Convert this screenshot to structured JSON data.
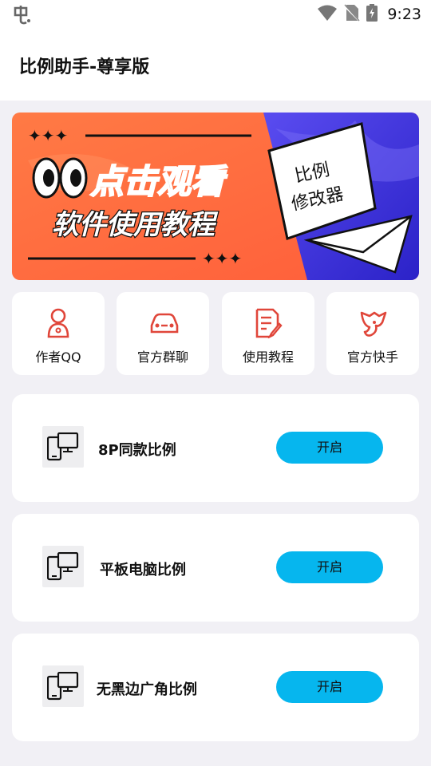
{
  "status_bar": {
    "time": "9:23",
    "icons": [
      "app-notification-icon",
      "wifi-icon",
      "no-sim-icon",
      "battery-charging-icon"
    ]
  },
  "app_bar": {
    "title": "比例助手-尊享版"
  },
  "banner": {
    "headline": "点击观看",
    "subheadline": "软件使用教程",
    "card_line1": "比例",
    "card_line2": "修改器",
    "colors": {
      "orange": "#ff6a3d",
      "blue": "#3b2fe0"
    }
  },
  "quick_actions": [
    {
      "label": "作者QQ",
      "icon": "person-icon"
    },
    {
      "label": "官方群聊",
      "icon": "car-icon"
    },
    {
      "label": "使用教程",
      "icon": "document-edit-icon"
    },
    {
      "label": "官方快手",
      "icon": "kuaishou-icon"
    }
  ],
  "modes": [
    {
      "label": "8P同款比例",
      "button": "开启",
      "icon": "phone-monitor-icon"
    },
    {
      "label": "平板电脑比例",
      "button": "开启",
      "icon": "phone-monitor-icon"
    },
    {
      "label": "无黑边广角比例",
      "button": "开启",
      "icon": "phone-monitor-icon"
    }
  ],
  "colors": {
    "accent_button": "#06b6ee",
    "icon_red": "#e0463a",
    "page_bg": "#f1f0f5"
  }
}
